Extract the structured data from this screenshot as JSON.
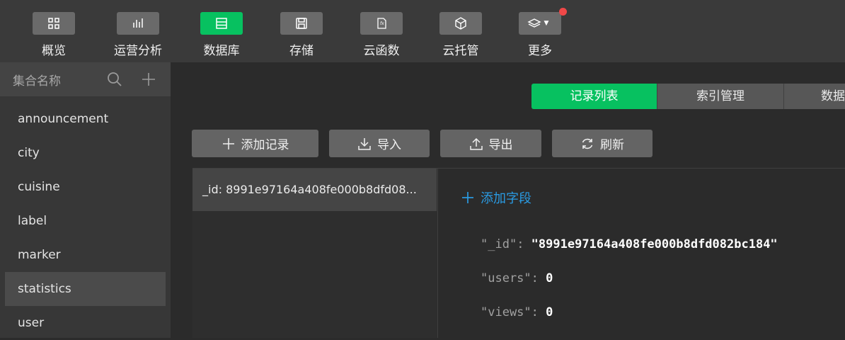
{
  "toolbar": {
    "items": [
      {
        "label": "概览",
        "icon": "grid-icon"
      },
      {
        "label": "运营分析",
        "icon": "bar-chart-icon"
      },
      {
        "label": "数据库",
        "icon": "database-icon"
      },
      {
        "label": "存储",
        "icon": "save-icon"
      },
      {
        "label": "云函数",
        "icon": "function-icon"
      },
      {
        "label": "云托管",
        "icon": "cube-icon"
      },
      {
        "label": "更多",
        "icon": "layers-icon"
      }
    ],
    "active_index": 2,
    "accent": "#07c160",
    "notification_color": "#f04848"
  },
  "sidebar": {
    "title": "集合名称",
    "items": [
      {
        "label": "announcement"
      },
      {
        "label": "city"
      },
      {
        "label": "cuisine"
      },
      {
        "label": "label"
      },
      {
        "label": "marker"
      },
      {
        "label": "statistics"
      },
      {
        "label": "user"
      }
    ],
    "selected": "statistics"
  },
  "main": {
    "tabs": [
      {
        "label": "记录列表"
      },
      {
        "label": "索引管理"
      },
      {
        "label": "数据"
      }
    ],
    "actions": {
      "add_record": "添加记录",
      "import": "导入",
      "export": "导出",
      "refresh": "刷新"
    },
    "records": [
      {
        "label": "_id: 8991e97164a408fe000b8dfd08..."
      }
    ],
    "detail": {
      "add_field": "添加字段",
      "fields": [
        {
          "key": "\"_id\"",
          "value": "\"8991e97164a408fe000b8dfd082bc184\""
        },
        {
          "key": "\"users\"",
          "value": "0"
        },
        {
          "key": "\"views\"",
          "value": "0"
        }
      ]
    }
  }
}
